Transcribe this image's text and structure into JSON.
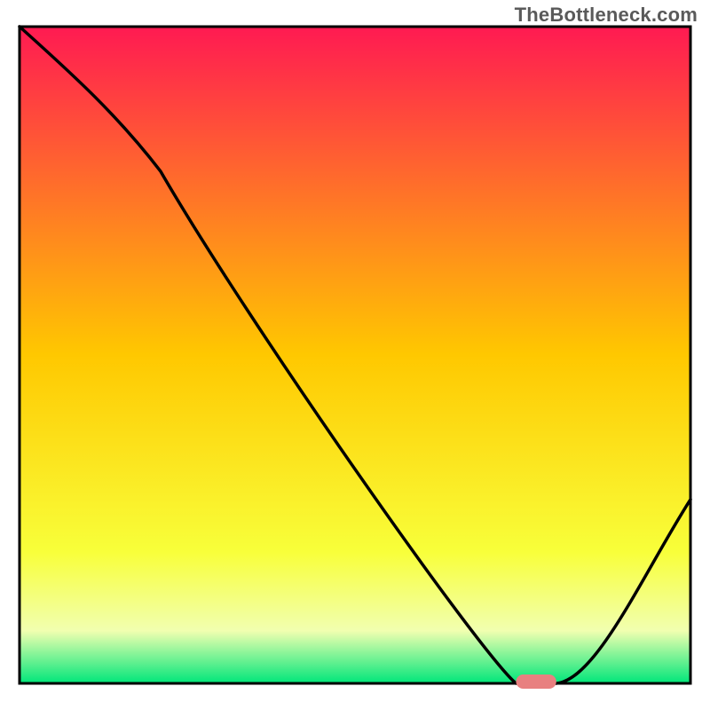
{
  "watermark": "TheBottleneck.com",
  "chart_data": {
    "type": "line",
    "title": "",
    "xlabel": "",
    "ylabel": "",
    "xlim": [
      0,
      100
    ],
    "ylim": [
      0,
      100
    ],
    "x": [
      0,
      21,
      74,
      80,
      100
    ],
    "y": [
      100,
      78,
      0,
      0,
      28
    ],
    "gradient_stops": [
      {
        "offset": 0,
        "color": "#ff1a52"
      },
      {
        "offset": 50,
        "color": "#ffc800"
      },
      {
        "offset": 80,
        "color": "#f8ff3a"
      },
      {
        "offset": 92,
        "color": "#f1ffb0"
      },
      {
        "offset": 100,
        "color": "#00e67a"
      }
    ],
    "marker": {
      "x": 77,
      "y": 0,
      "width": 6,
      "color": "#e88080"
    },
    "border_color": "#000000",
    "line_color": "#000000"
  }
}
